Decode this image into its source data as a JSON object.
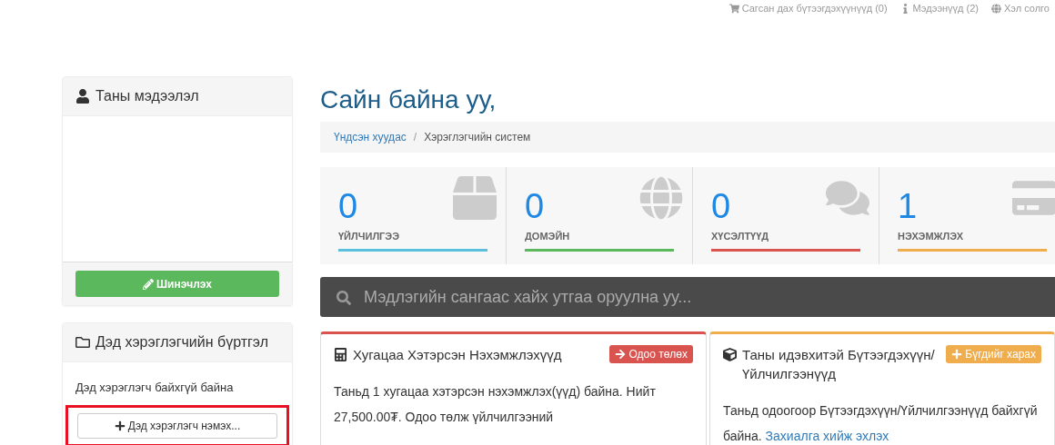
{
  "top_nav": [
    {
      "kind": "cart",
      "label": "Сагсан дах бүтээгдэхүүнүүд (0)"
    },
    {
      "kind": "news",
      "label": "Мэдээнүүд (2)"
    },
    {
      "kind": "language",
      "label": "Хэл солго"
    }
  ],
  "sidebar": {
    "profile": {
      "title": "Таны мэдээлэл",
      "button": "Шинэчлэх"
    },
    "subaccounts": {
      "title": "Дэд хэрэглэгчийн бүртгэл",
      "message": "Дэд хэрэглэгч байхгүй байна",
      "button": "Дэд хэрэглэгч нэмэх...",
      "highlighted": true
    }
  },
  "greeting": "Сайн байна уу,",
  "breadcrumb_separator": "/",
  "breadcrumb": [
    {
      "label": "Үндсэн хуудас",
      "link": true
    },
    {
      "label": "Хэрэглэгчийн систем",
      "link": false
    }
  ],
  "stats": [
    {
      "kind": "services",
      "value": "0",
      "label": "ҮЙЛЧИЛГЭЭ",
      "color": "#5bc0de"
    },
    {
      "kind": "domains",
      "value": "0",
      "label": "ДОМЭЙН",
      "color": "#5cb85c"
    },
    {
      "kind": "tickets",
      "value": "0",
      "label": "ХҮСЭЛТҮҮД",
      "color": "#d9534f"
    },
    {
      "kind": "invoices",
      "value": "1",
      "label": "НЭХЭМЖЛЭХ",
      "color": "#f0ad4e"
    }
  ],
  "search": {
    "placeholder": "Мэдлэгийн сангаас хайх утгаа оруулна уу..."
  },
  "panels": [
    {
      "kind": "invoices",
      "title": "Хугацаа Хэтэрсэн Нэхэмжлэхүүд",
      "action": "Одоо төлөх",
      "color": "#d9534f",
      "body": "Таньд 1 хугацаа хэтэрсэн нэхэмжлэх(үүд) байна. Нийт 27,500.00₮. Одоо төлж үйлчилгээний"
    },
    {
      "kind": "products",
      "title": "Таны идэвхитэй Бүтээгдэхүүн/ Үйлчилгээнүүд",
      "action": "Бүгдийг харах",
      "color": "#f0ad4e",
      "body": "Таньд одоогоор Бүтээгдэхүүн/Үйлчилгээнүүд байхгүй байна.",
      "link": "Захиалга хийж эхлэх"
    }
  ]
}
